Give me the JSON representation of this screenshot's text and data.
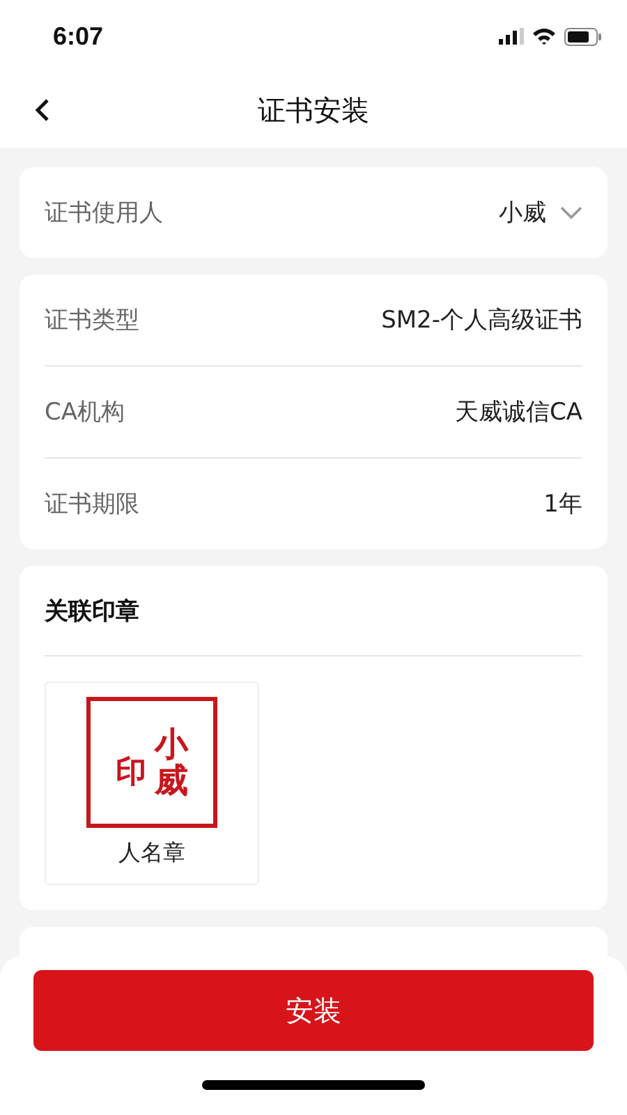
{
  "status_bar": {
    "time": "6:07"
  },
  "nav": {
    "title": "证书安装"
  },
  "user_card": {
    "label": "证书使用人",
    "value": "小威"
  },
  "info_rows": [
    {
      "label": "证书类型",
      "value": "SM2-个人高级证书"
    },
    {
      "label": "CA机构",
      "value": "天威诚信CA"
    },
    {
      "label": "证书期限",
      "value": "1年"
    }
  ],
  "seal_section": {
    "title": "关联印章",
    "seals": [
      {
        "name_text": "小威",
        "mark_text": "印",
        "label": "人名章"
      }
    ]
  },
  "install_button": "安装"
}
